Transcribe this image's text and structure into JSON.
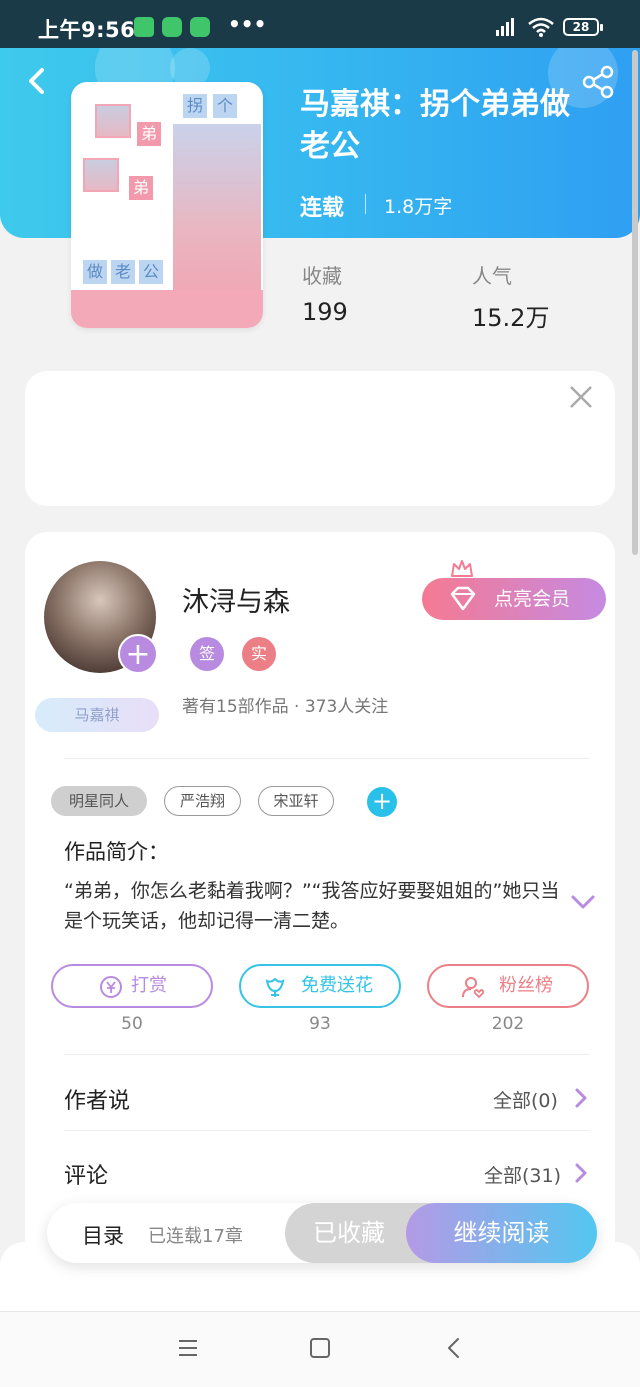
{
  "status_bar": {
    "time": "上午9:56",
    "dots": "•••",
    "battery": "28"
  },
  "book": {
    "title": "马嘉祺：拐个弟弟做老公",
    "status": "连载",
    "word_count": "1.8万字",
    "cover_chars": [
      "拐",
      "个",
      "弟",
      "弟",
      "做",
      "老",
      "公"
    ],
    "stats": [
      {
        "label": "收藏",
        "value": "199"
      },
      {
        "label": "人气",
        "value": "15.2万"
      }
    ]
  },
  "author": {
    "name": "沐浔与森",
    "badges": [
      "签",
      "实"
    ],
    "fan_tag": "马嘉祺",
    "stats_text": "著有15部作品 · 373人关注",
    "vip_label": "点亮会员"
  },
  "tags": [
    "明星同人",
    "严浩翔",
    "宋亚轩"
  ],
  "intro": {
    "label": "作品简介：",
    "text": "“弟弟，你怎么老黏着我啊？”“我答应好要娶姐姐的”她只当是个玩笑话，他却记得一清二楚。"
  },
  "actions": [
    {
      "label": "打赏",
      "count": "50",
      "color": "#b88be0"
    },
    {
      "label": "免费送花",
      "count": "93",
      "color": "#36c3e6"
    },
    {
      "label": "粉丝榜",
      "count": "202",
      "color": "#ec7f86"
    }
  ],
  "rows": [
    {
      "label": "作者说",
      "right": "全部(0)"
    },
    {
      "label": "评论",
      "right": "全部(31)"
    }
  ],
  "bottom_bar": {
    "toc_label": "目录",
    "toc_sub": "已连载17章",
    "fav_label": "已收藏",
    "read_label": "继续阅读"
  },
  "colors": {
    "header_blue": "#35b5f0",
    "accent_purple": "#b88be0",
    "accent_pink": "#f57a92"
  }
}
